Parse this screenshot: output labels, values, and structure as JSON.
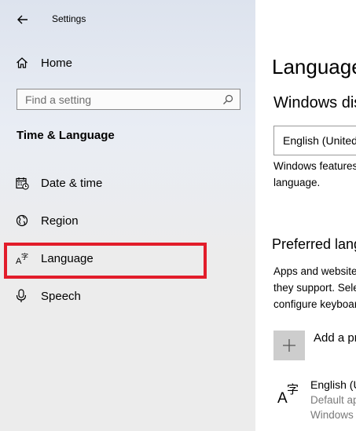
{
  "window": {
    "title": "Settings"
  },
  "sidebar": {
    "home_label": "Home",
    "search_placeholder": "Find a setting",
    "section_title": "Time & Language",
    "items": [
      {
        "label": "Date & time",
        "icon": "calendar-clock-icon"
      },
      {
        "label": "Region",
        "icon": "globe-icon"
      },
      {
        "label": "Language",
        "icon": "language-icon"
      },
      {
        "label": "Speech",
        "icon": "microphone-icon"
      }
    ],
    "highlight_color": "#e21c2a"
  },
  "main": {
    "heading": "Language",
    "windows_display": {
      "heading": "Windows display language",
      "selected": "English (United States)",
      "description_lines": [
        "Windows features like Settings and File Explorer will appear in this",
        "language."
      ]
    },
    "preferred": {
      "heading": "Preferred languages",
      "description_lines": [
        "Apps and websites will appear in the first language in the list that",
        "they support. Select a language and then select Options to",
        "configure keyboards and other features."
      ],
      "add_label": "Add a preferred language",
      "languages": [
        {
          "name": "English (United States)",
          "sub_lines": [
            "Default app language",
            "Windows display language"
          ]
        }
      ]
    }
  }
}
